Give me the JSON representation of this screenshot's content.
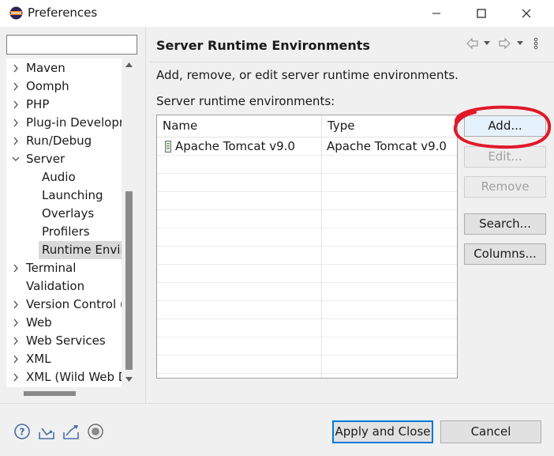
{
  "window": {
    "title": "Preferences"
  },
  "filter": {
    "value": "",
    "placeholder": ""
  },
  "tree": {
    "items": [
      {
        "label": "Maven",
        "level": 0,
        "expandable": true,
        "expanded": false
      },
      {
        "label": "Oomph",
        "level": 0,
        "expandable": true,
        "expanded": false
      },
      {
        "label": "PHP",
        "level": 0,
        "expandable": true,
        "expanded": false
      },
      {
        "label": "Plug-in Developm",
        "level": 0,
        "expandable": true,
        "expanded": false
      },
      {
        "label": "Run/Debug",
        "level": 0,
        "expandable": true,
        "expanded": false
      },
      {
        "label": "Server",
        "level": 0,
        "expandable": true,
        "expanded": true
      },
      {
        "label": "Audio",
        "level": 1,
        "expandable": false
      },
      {
        "label": "Launching",
        "level": 1,
        "expandable": false
      },
      {
        "label": "Overlays",
        "level": 1,
        "expandable": false
      },
      {
        "label": "Profilers",
        "level": 1,
        "expandable": false
      },
      {
        "label": "Runtime Enviro",
        "level": 1,
        "expandable": false,
        "selected": true
      },
      {
        "label": "Terminal",
        "level": 0,
        "expandable": true,
        "expanded": false
      },
      {
        "label": "Validation",
        "level": 0,
        "expandable": false
      },
      {
        "label": "Version Control (",
        "level": 0,
        "expandable": true,
        "expanded": false
      },
      {
        "label": "Web",
        "level": 0,
        "expandable": true,
        "expanded": false
      },
      {
        "label": "Web Services",
        "level": 0,
        "expandable": true,
        "expanded": false
      },
      {
        "label": "XML",
        "level": 0,
        "expandable": true,
        "expanded": false
      },
      {
        "label": "XML (Wild Web D",
        "level": 0,
        "expandable": true,
        "expanded": false
      }
    ]
  },
  "page": {
    "title": "Server Runtime Environments",
    "description": "Add, remove, or edit server runtime environments.",
    "table_label": "Server runtime environments:"
  },
  "table": {
    "columns": [
      "Name",
      "Type"
    ],
    "rows": [
      {
        "name": "Apache Tomcat v9.0",
        "type": "Apache Tomcat v9.0"
      }
    ]
  },
  "buttons": {
    "add": "Add...",
    "edit": "Edit...",
    "remove": "Remove",
    "search": "Search...",
    "columns": "Columns...",
    "apply_close": "Apply and Close",
    "cancel": "Cancel"
  },
  "icons": {
    "help": "help-icon",
    "import": "import-icon",
    "export": "export-icon",
    "record": "record-icon"
  },
  "colors": {
    "annotation": "#e0192a",
    "accent": "#0078d7"
  }
}
